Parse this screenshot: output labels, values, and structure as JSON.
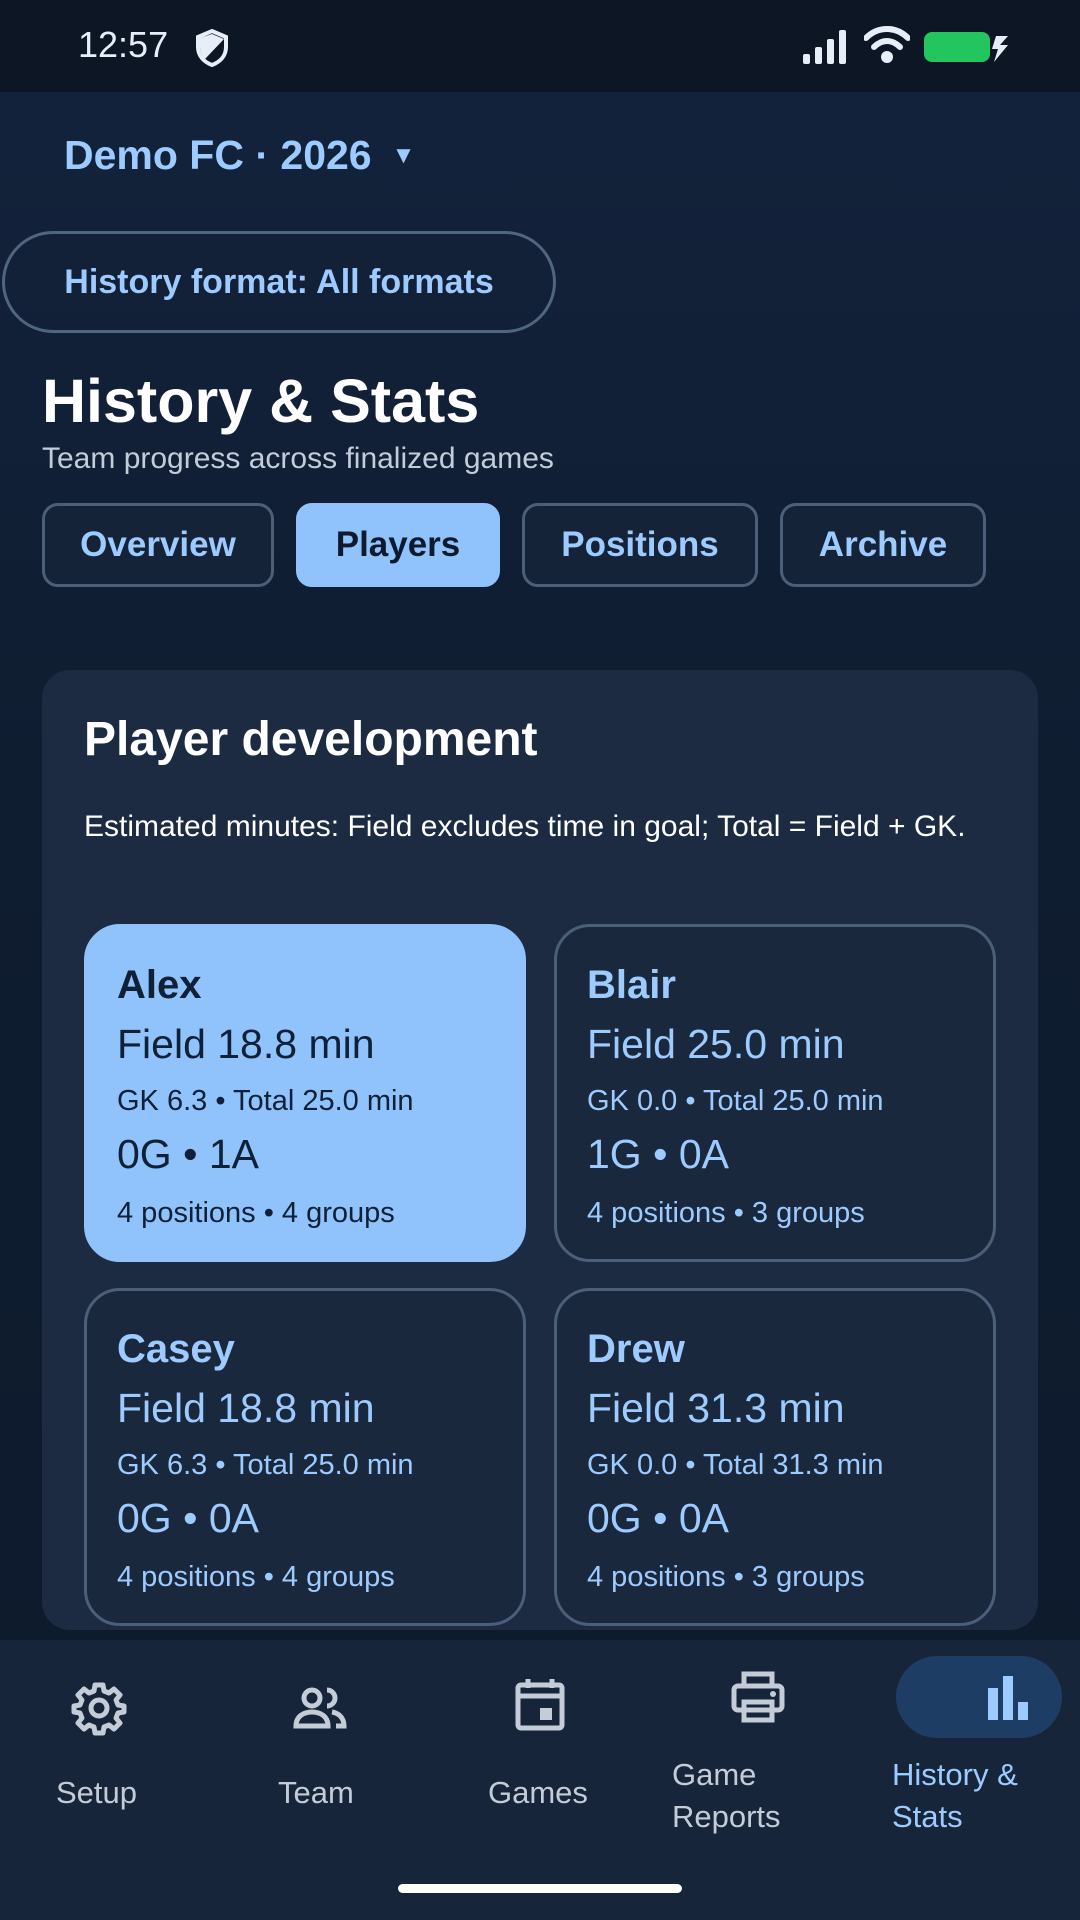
{
  "status_bar": {
    "time": "12:57",
    "icons": [
      "shield-icon",
      "signal-icon",
      "wifi-icon",
      "battery-charging-icon"
    ],
    "battery_color": "#22c55e"
  },
  "header": {
    "team_selector": "Demo FC · 2026",
    "caret": "▼",
    "format_chip": "History format: All formats",
    "title": "History & Stats",
    "subtitle": "Team progress across finalized games"
  },
  "tabs": [
    {
      "label": "Overview",
      "active": false
    },
    {
      "label": "Players",
      "active": true
    },
    {
      "label": "Positions",
      "active": false
    },
    {
      "label": "Archive",
      "active": false
    }
  ],
  "dev_card": {
    "title": "Player development",
    "note": "Estimated minutes: Field excludes time in goal; Total = Field + GK.",
    "players": [
      {
        "name": "Alex",
        "field": "Field 18.8 min",
        "gk_total": "GK 6.3 • Total 25.0 min",
        "goals_assists": "0G • 1A",
        "positions": "4 positions • 4 groups",
        "selected": true
      },
      {
        "name": "Blair",
        "field": "Field 25.0 min",
        "gk_total": "GK 0.0 • Total 25.0 min",
        "goals_assists": "1G • 0A",
        "positions": "4 positions • 3 groups",
        "selected": false
      },
      {
        "name": "Casey",
        "field": "Field 18.8 min",
        "gk_total": "GK 6.3 • Total 25.0 min",
        "goals_assists": "0G • 0A",
        "positions": "4 positions • 4 groups",
        "selected": false
      },
      {
        "name": "Drew",
        "field": "Field 31.3 min",
        "gk_total": "GK 0.0 • Total 31.3 min",
        "goals_assists": "0G • 0A",
        "positions": "4 positions • 3 groups",
        "selected": false
      }
    ]
  },
  "bottom_nav": [
    {
      "label": "Setup",
      "icon": "gear-icon",
      "active": false
    },
    {
      "label": "Team",
      "icon": "people-icon",
      "active": false
    },
    {
      "label": "Games",
      "icon": "calendar-icon",
      "active": false
    },
    {
      "label_line1": "Game",
      "label_line2": "Reports",
      "icon": "printer-icon",
      "active": false
    },
    {
      "label_line1": "History &",
      "label_line2": "Stats",
      "icon": "bar-chart-icon",
      "active": true
    }
  ],
  "colors": {
    "accent": "#9ecbff",
    "active_fill": "#90c2fc",
    "background": "#0f1d31",
    "card": "#1c2b41"
  }
}
